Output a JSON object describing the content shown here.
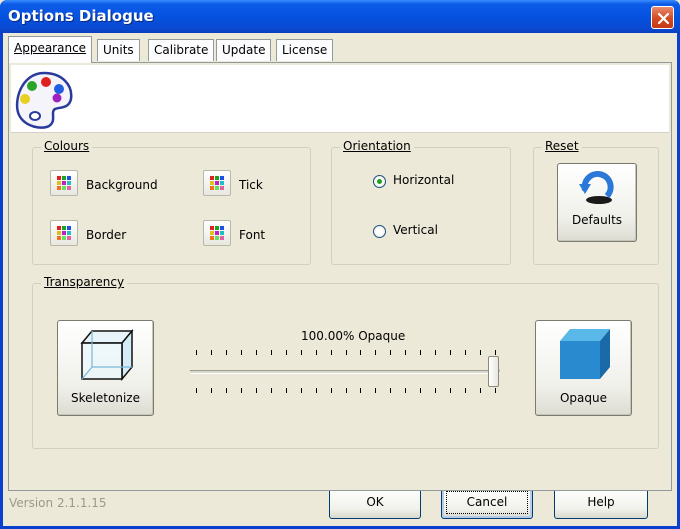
{
  "window": {
    "title": "Options Dialogue"
  },
  "tabs": [
    {
      "label": "Appearance",
      "active": true
    },
    {
      "label": "Units",
      "active": false
    },
    {
      "label": "Calibrate",
      "active": false
    },
    {
      "label": "Update",
      "active": false
    },
    {
      "label": "License",
      "active": false
    }
  ],
  "colours": {
    "legend": "Colours",
    "buttons": [
      "Background",
      "Tick",
      "Border",
      "Font"
    ]
  },
  "orientation": {
    "legend": "Orientation",
    "options": [
      "Horizontal",
      "Vertical"
    ],
    "selected": "Horizontal"
  },
  "reset": {
    "legend": "Reset",
    "button": "Defaults"
  },
  "transparency": {
    "legend": "Transparency",
    "left_button": "Skeletonize",
    "right_button": "Opaque",
    "caption": "100.00% Opaque",
    "slider_value_percent": 100
  },
  "footer": {
    "version": "Version 2.1.1.15",
    "ok": "OK",
    "cancel": "Cancel",
    "help": "Help"
  },
  "icons": [
    "close-icon",
    "palette-icon",
    "color-grid-icon",
    "refresh-arrow-icon",
    "wireframe-cube-icon",
    "solid-cube-icon"
  ],
  "colors": {
    "title_blue": "#0552e0",
    "close_red": "#d24a22",
    "radio_dot": "#21a121"
  }
}
